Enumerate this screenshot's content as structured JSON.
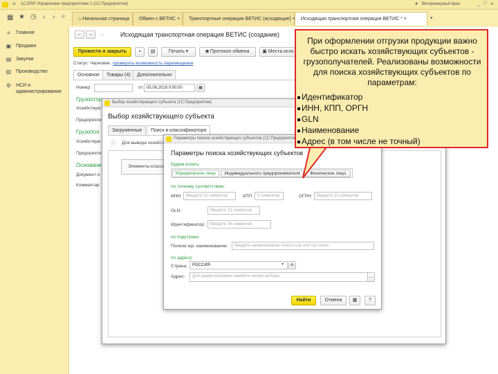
{
  "app": {
    "title": "1С:ERP Управление предприятием 2 (1С:Предприятие)",
    "user": "Ветеринарный врач"
  },
  "tabs": [
    {
      "label": "Начальная страница"
    },
    {
      "label": "Обмен с ВЕТИС",
      "close": "×"
    },
    {
      "label": "Транспортные операции ВЕТИС (исходящие)",
      "close": "×"
    },
    {
      "label": "Исходящая транспортная операция ВЕТИС *",
      "close": "×"
    }
  ],
  "sidebar": {
    "items": [
      {
        "label": "Главное",
        "icon": "menu-icon",
        "glyph": "≡"
      },
      {
        "label": "Продажи",
        "icon": "cart-icon",
        "glyph": "▣"
      },
      {
        "label": "Закупки",
        "icon": "bag-icon",
        "glyph": "▤"
      },
      {
        "label": "Производство",
        "icon": "factory-icon",
        "glyph": "▥"
      },
      {
        "label": "НСИ и администрирование",
        "icon": "gear-icon",
        "glyph": "⚙"
      }
    ]
  },
  "form": {
    "title": "Исходящая транспортная операция ВЕТИС (создание)",
    "post_close": "Провести и закрыть",
    "print": "Печать",
    "protocol": "Протокол обмена",
    "place": "Места исхо",
    "status_label": "Статус:",
    "status_value": "Черновик.",
    "status_link": "проверить возможность перемещения",
    "tabs": [
      "Основное",
      "Товары (4)",
      "Дополнительно"
    ],
    "number_label": "Номер:",
    "date_from_label": "от:",
    "date_value": "05.06.2018  0:00:00",
    "left_labels": [
      "Грузоотпр",
      "Хозяйствую",
      "Предприяти",
      "Грузопол",
      "Хозяйствую",
      "Предприяти",
      "Основани",
      "Документ-о",
      "Комментар"
    ]
  },
  "dialog1": {
    "window_title": "Выбор хозяйствующего субъекта  (1С:Предприятие)",
    "title": "Выбор хозяйствующего субъекта",
    "tabs": [
      "Загруженные",
      "Поиск в классификаторе"
    ],
    "info": "Для вывода хозяйств",
    "list_text": "Элементы классиф"
  },
  "dialog2": {
    "window_title": "Параметры поиска хозяйствующих субъектов  (1С:Предприятие)",
    "title": "Параметры поиска хозяйствующих субъектов",
    "search_section": "Будем искать:",
    "type_buttons": [
      "Юридическое лицо",
      "Индивидуального предпринимателя",
      "Физическое лицо"
    ],
    "exact_section": "по точному соответствию:",
    "inn_label": "ИНН:",
    "inn_placeholder": "Введите 10 символов",
    "kpp_label": "КПП:",
    "kpp_placeholder": "9 символов",
    "ogrn_label": "ОГРН:",
    "ogrn_placeholder": "Введите 13 символов",
    "gln_label": "GLN:",
    "gln_placeholder": "Введите 13 символов",
    "id_label": "Идентификатор:",
    "id_placeholder": "Введите 36 символов",
    "substring_section": "по подстроке:",
    "name_label": "Полное юр. наименование:",
    "name_placeholder": "Введите наименование полностью или частично",
    "address_section": "по адресу:",
    "country_label": "Страна:",
    "country_value": "РОССИЯ",
    "address_label": "Адрес:",
    "address_placeholder": "Для редактирования нажмите кнопку выбора",
    "find": "Найти",
    "cancel": "Отмена"
  },
  "callout": {
    "intro": "При оформлении отгрузки продукции важно быстро искать хозяйствующих субъектов - грузополучателей. Реализованы возможности для поиска хозяйствующих субъектов по параметрам:",
    "items": [
      "Идентификатор",
      "ИНН, КПП, ОРГН",
      "GLN",
      "Наименование",
      "Адрес (в том числе не точный)"
    ]
  },
  "colors": {
    "accent": "#f2d600",
    "callout_border": "#e02626",
    "callout_bg": "#fbedb0",
    "section_green": "#2a9a3a"
  }
}
